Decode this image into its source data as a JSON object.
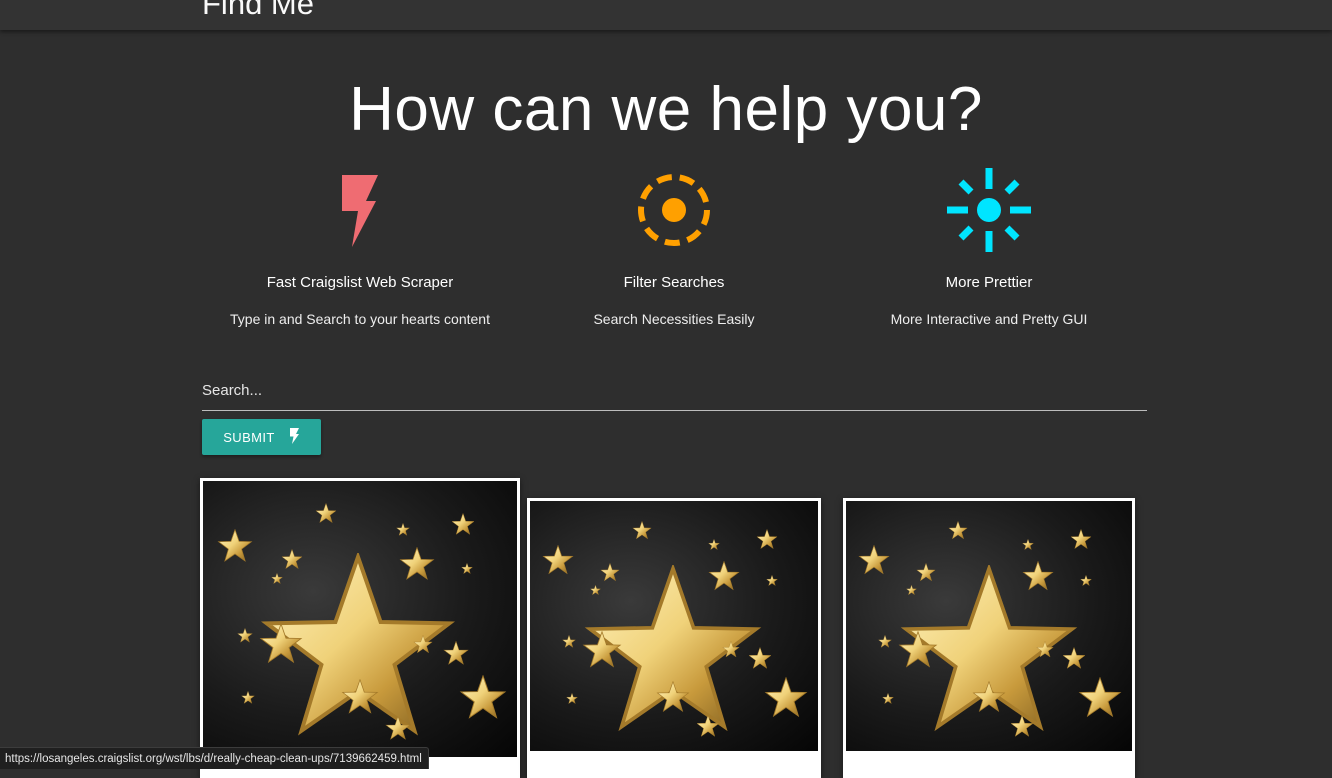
{
  "navbar": {
    "brand": "Find Me"
  },
  "hero": {
    "title": "How can we help you?"
  },
  "features": [
    {
      "icon": "flash-icon",
      "color": "#ef6c72",
      "title": "Fast Craigslist Web Scraper",
      "description": "Type in and Search to your hearts content"
    },
    {
      "icon": "target-icon",
      "color": "#ffa000",
      "title": "Filter Searches",
      "description": "Search Necessities Easily"
    },
    {
      "icon": "brightness-icon",
      "color": "#00e5ff",
      "title": "More Prettier",
      "description": "More Interactive and Pretty GUI"
    }
  ],
  "search": {
    "placeholder": "Search...",
    "value": ""
  },
  "submit": {
    "label": "SUBMIT",
    "icon": "flash-icon",
    "color": "#26a69a"
  },
  "cards": [
    {
      "image": "gold-stars-image"
    },
    {
      "image": "gold-stars-image"
    },
    {
      "image": "gold-stars-image"
    }
  ],
  "status_bar": {
    "url": "https://losangeles.craigslist.org/wst/lbs/d/really-cheap-clean-ups/7139662459.html"
  }
}
